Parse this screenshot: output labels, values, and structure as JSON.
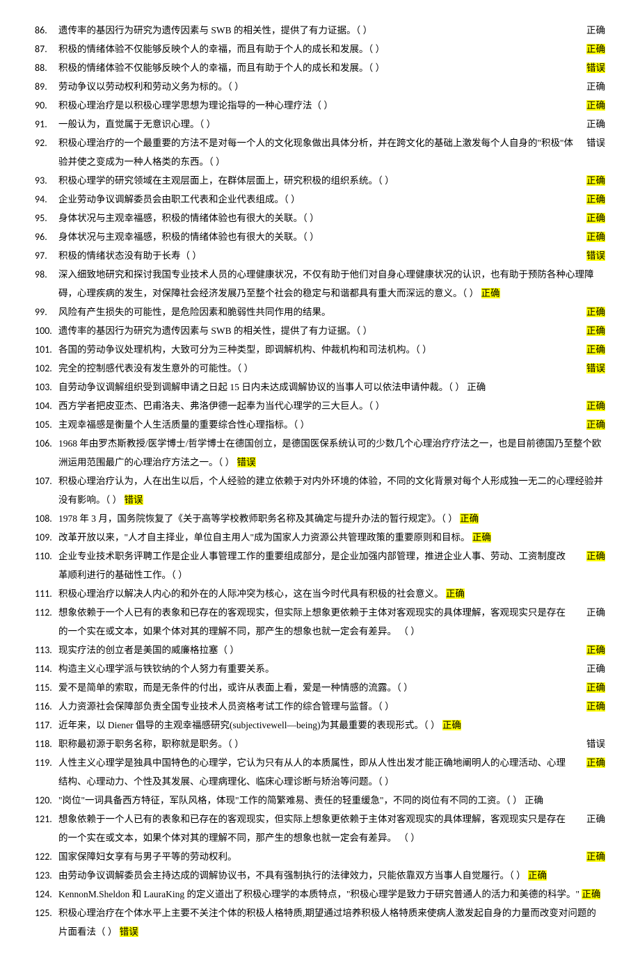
{
  "items": [
    {
      "num": "86.",
      "text": "遗传率的基因行为研究为遗传因素与 SWB 的相关性，提供了有力证据。（ ）",
      "answer": "正确",
      "hl": false,
      "inline": false
    },
    {
      "num": "87.",
      "text": "积极的情绪体验不仅能够反映个人的幸福，而且有助于个人的成长和发展。（ ）",
      "answer": "正确",
      "hl": true,
      "inline": false
    },
    {
      "num": "88.",
      "text": "积极的情绪体验不仅能够反映个人的幸福，而且有助于个人的成长和发展。（ ）",
      "answer": "错误",
      "hl": true,
      "inline": false
    },
    {
      "num": "89.",
      "text": "劳动争议以劳动权利和劳动义务为标的。（ ）",
      "answer": "正确",
      "hl": false,
      "inline": false
    },
    {
      "num": "90.",
      "text": "积极心理治疗是以积极心理学思想为理论指导的一种心理疗法（ ）",
      "answer": "正确",
      "hl": true,
      "inline": false
    },
    {
      "num": "91.",
      "text": "一般认为，直觉属于无意识心理。（ ）",
      "answer": "正确",
      "hl": false,
      "inline": false
    },
    {
      "num": "92.",
      "text": "积极心理治疗的一个最重要的方法不是对每一个人的文化现象做出具体分析，并在跨文化的基础上激发每个人自身的\"积极\"体验并使之变成为一种人格类的东西。（ ）",
      "answer": "错误",
      "hl": false,
      "inline": false
    },
    {
      "num": "93.",
      "text": "积极心理学的研究领域在主观层面上，在群体层面上，研究积极的组织系统。（ ）",
      "answer": "正确",
      "hl": true,
      "inline": false
    },
    {
      "num": "94.",
      "text": "企业劳动争议调解委员会由职工代表和企业代表组成。（ ）",
      "answer": "正确",
      "hl": true,
      "inline": false
    },
    {
      "num": "95.",
      "text": "身体状况与主观幸福感，积极的情绪体验也有很大的关联。（ ）",
      "answer": "正确",
      "hl": true,
      "inline": false
    },
    {
      "num": "96.",
      "text": "身体状况与主观幸福感，积极的情绪体验也有很大的关联。（ ）",
      "answer": "正确",
      "hl": true,
      "inline": false
    },
    {
      "num": "97.",
      "text": "积极的情绪状态没有助于长寿（ ）",
      "answer": "错误",
      "hl": true,
      "inline": false
    },
    {
      "num": "98.",
      "text": "深入细致地研究和探讨我国专业技术人员的心理健康状况，不仅有助于他们对自身心理健康状况的认识，也有助于预防各种心理障碍，心理疾病的发生，对保障社会经济发展乃至整个社会的稳定与和谐都具有重大而深远的意义。（ ）",
      "answer": "正确",
      "hl": true,
      "inline": true
    },
    {
      "num": "99.",
      "text": "风险有产生损失的可能性，是危险因素和脆弱性共同作用的结果。",
      "answer": "正确",
      "hl": true,
      "inline": false
    },
    {
      "num": "100.",
      "text": "遗传率的基因行为研究为遗传因素与 SWB 的相关性，提供了有力证据。（ ）",
      "answer": "正确",
      "hl": true,
      "inline": false
    },
    {
      "num": "101.",
      "text": "各国的劳动争议处理机构，大致可分为三种类型，即调解机构、仲裁机构和司法机构。（ ）",
      "answer": "正确",
      "hl": true,
      "inline": false
    },
    {
      "num": "102.",
      "text": "完全的控制感代表没有发生意外的可能性。（ ）",
      "answer": "错误",
      "hl": true,
      "inline": false
    },
    {
      "num": "103.",
      "text": "自劳动争议调解组织受到调解申请之日起 15 日内未达成调解协议的当事人可以依法申请仲裁。（ ）",
      "answer": "正确",
      "hl": false,
      "inline": true
    },
    {
      "num": "104.",
      "text": "西方学者把皮亚杰、巴甫洛夫、弗洛伊德一起奉为当代心理学的三大巨人。（ ）",
      "answer": "正确",
      "hl": true,
      "inline": false
    },
    {
      "num": "105.",
      "text": "主观幸福感是衡量个人生活质量的重要综合性心理指标。（ ）",
      "answer": "正确",
      "hl": true,
      "inline": false
    },
    {
      "num": "106.",
      "text": "1968 年由罗杰斯教授/医学博士/哲学博士在德国创立，是德国医保系统认可的少数几个心理治疗疗法之一，也是目前德国乃至整个欧洲运用范围最广的心理治疗方法之一。（ ）",
      "answer": "错误",
      "hl": true,
      "inline": true
    },
    {
      "num": "107.",
      "text": "积极心理治疗认为，人在出生以后，个人经验的建立依赖于对内外环境的体验，不同的文化背景对每个人形成独一无二的心理经验并没有影响。（ ）",
      "answer": "错误",
      "hl": true,
      "inline": true
    },
    {
      "num": "108.",
      "text": "1978 年 3 月，国务院恢复了《关于高等学校教师职务名称及其确定与提升办法的暂行规定》。（ ）",
      "answer": "正确",
      "hl": true,
      "inline": true
    },
    {
      "num": "109.",
      "text": "改革开放以来，\"人才自主择业，单位自主用人\"成为国家人力资源公共管理政策的重要原则和目标。",
      "answer": "正确",
      "hl": true,
      "inline": true
    },
    {
      "num": "110.",
      "text": "企业专业技术职务评聘工作是企业人事管理工作的重要组成部分，是企业加强内部管理，推进企业人事、劳动、工资制度改革顺利进行的基础性工作。（ ）",
      "answer": "正确",
      "hl": true,
      "inline": false
    },
    {
      "num": "111.",
      "text": "积极心理治疗以解决人内心的和外在的人际冲突为核心，这在当今时代具有积极的社会意义。",
      "answer": "正确",
      "hl": true,
      "inline": true
    },
    {
      "num": "112.",
      "text": "想象依赖于一个人已有的表象和已存在的客观现实，但实际上想象更依赖于主体对客观现实的具体理解，客观现实只是存在的一个实在或文本，如果个体对其的理解不同，那产生的想象也就一定会有差异。 （ ）",
      "answer": "正确",
      "hl": false,
      "inline": false
    },
    {
      "num": "113.",
      "text": "现实疗法的创立者是美国的威廉格拉塞（ ）",
      "answer": "正确",
      "hl": true,
      "inline": false
    },
    {
      "num": "114.",
      "text": "构造主义心理学派与铁钦纳的个人努力有重要关系。",
      "answer": "正确",
      "hl": false,
      "inline": false
    },
    {
      "num": "115.",
      "text": "爱不是简单的索取，而是无条件的付出，或许从表面上看，爱是一种情感的流露。（ ）",
      "answer": "正确",
      "hl": true,
      "inline": false
    },
    {
      "num": "116.",
      "text": "人力资源社会保障部负责全国专业技术人员资格考试工作的综合管理与监督。（ ）",
      "answer": "正确",
      "hl": true,
      "inline": false
    },
    {
      "num": "117.",
      "text": "近年来，以 Diener 倡导的主观幸福感研究(subjectivewell—being)为其最重要的表现形式。（ ）",
      "answer": "正确",
      "hl": true,
      "inline": true
    },
    {
      "num": "118.",
      "text": "职称最初源于职务名称，职称就是职务。（ ）",
      "answer": "错误",
      "hl": false,
      "inline": false
    },
    {
      "num": "119.",
      "text": "人性主义心理学是独具中国特色的心理学，它认为只有从人的本质属性，即从人性出发才能正确地阐明人的心理活动、心理结构、心理动力、个性及其发展、心理病理化、临床心理诊断与矫治等问题。（ ）",
      "answer": "正确",
      "hl": true,
      "inline": false
    },
    {
      "num": "120.",
      "text": "\"岗位\"一词具备西方特征，军队风格，体现\"工作的简繁难易、责任的轻重缓急\"，不同的岗位有不同的工资。（ ）",
      "answer": "正确",
      "hl": false,
      "inline": true
    },
    {
      "num": "121.",
      "text": "想象依赖于一个人已有的表象和已存在的客观现实，但实际上想象更依赖于主体对客观现实的具体理解，客观现实只是存在的一个实在或文本，如果个体对其的理解不同，那产生的想象也就一定会有差异。 （ ）",
      "answer": "正确",
      "hl": false,
      "inline": false
    },
    {
      "num": "122.",
      "text": "国家保障妇女享有与男子平等的劳动权利。",
      "answer": "正确",
      "hl": true,
      "inline": false
    },
    {
      "num": "123.",
      "text": "由劳动争议调解委员会主持达成的调解协议书，不具有强制执行的法律效力，只能依靠双方当事人自觉履行。（ ）",
      "answer": "正确",
      "hl": true,
      "inline": true
    },
    {
      "num": "124.",
      "text": "KennonM.Sheldon 和 LauraKing 的定义道出了积极心理学的本质特点，\"积极心理学是致力于研究普通人的活力和美德的科学。\"",
      "answer": "正确",
      "hl": true,
      "inline": true
    },
    {
      "num": "125.",
      "text": "积极心理治疗在个体水平上主要不关注个体的积极人格特质,期望通过培养积极人格特质来使病人激发起自身的力量而改变对问题的片面看法（ ）",
      "answer": "错误",
      "hl": true,
      "inline": true
    }
  ]
}
